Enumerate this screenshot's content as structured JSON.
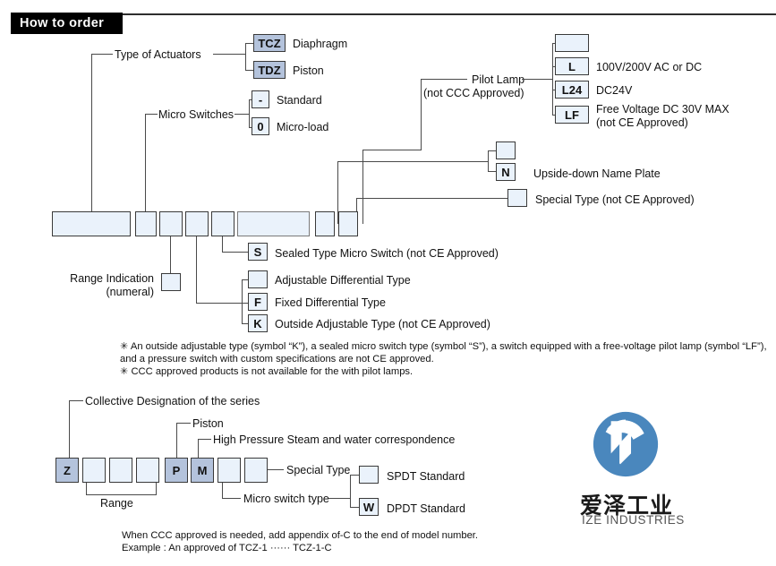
{
  "header": {
    "title": "How to order"
  },
  "top_diagram": {
    "branches": [
      {
        "label": "Type of Actuators",
        "options": [
          {
            "code": "TCZ",
            "desc": "Diaphragm"
          },
          {
            "code": "TDZ",
            "desc": "Piston"
          }
        ]
      },
      {
        "label": "Micro Switches",
        "options": [
          {
            "code": "-",
            "desc": "Standard"
          },
          {
            "code": "0",
            "desc": "Micro-load"
          }
        ]
      },
      {
        "label": "Pilot Lamp",
        "label_sub": "(not CCC Approved)",
        "options": [
          {
            "code": "",
            "desc": ""
          },
          {
            "code": "L",
            "desc": "100V/200V AC or DC"
          },
          {
            "code": "L24",
            "desc": "DC24V"
          },
          {
            "code": "LF",
            "desc": "Free Voltage DC 30V MAX",
            "desc2": "(not CE Approved)"
          }
        ]
      },
      {
        "label": "",
        "options": [
          {
            "code": "",
            "desc": ""
          },
          {
            "code": "N",
            "desc": "Upside-down Name Plate"
          }
        ]
      },
      {
        "label": "",
        "options": [
          {
            "code": "",
            "desc": "Special Type (not CE Approved)"
          }
        ]
      }
    ],
    "range_indication": {
      "line1": "Range Indication",
      "line2": "(numeral)",
      "code": ""
    },
    "sealed": {
      "code": "S",
      "desc": "Sealed Type Micro Switch (not CE Approved)"
    },
    "differential": [
      {
        "code": "",
        "desc": "Adjustable Differential Type"
      },
      {
        "code": "F",
        "desc": "Fixed Differential Type"
      },
      {
        "code": "K",
        "desc": "Outside Adjustable Type (not CE Approved)"
      }
    ]
  },
  "footnotes": [
    "✳ An outside adjustable type (symbol “K”), a sealed micro switch type (symbol “S”), a switch equipped with a free-voltage pilot lamp (symbol “LF”),",
    "   and a pressure switch with custom specifications are not CE approved.",
    "✳ CCC approved products is not available for the with pilot lamps."
  ],
  "bottom_diagram": {
    "codes": [
      "Z",
      "",
      "",
      "",
      "P",
      "M",
      "",
      ""
    ],
    "shaded_indices": [
      0,
      4,
      5
    ],
    "labels": {
      "collective": "Collective Designation of the series",
      "piston": "Piston",
      "high_pressure": "High Pressure Steam and water correspondence",
      "special_type": "Special Type",
      "range": "Range",
      "micro_switch_type": "Micro switch type"
    },
    "micro_switch_options": [
      {
        "code": "",
        "desc": "SPDT Standard"
      },
      {
        "code": "W",
        "desc": "DPDT Standard"
      }
    ],
    "ccc_note": [
      "When CCC approved is needed, add appendix of-C to the end of model number.",
      "Example : An approved of TCZ-1 ······ TCZ-1-C"
    ]
  },
  "logo": {
    "chinese": "爱泽工业",
    "english": "IZE INDUSTRIES",
    "color": "#4a87bd"
  },
  "colors": {
    "box_fill": "#eaf2fb",
    "box_fill_shaded": "#b4c3dc",
    "box_border": "#3a3a3a",
    "line": "#4a4a4a",
    "header_bg": "#000000"
  }
}
